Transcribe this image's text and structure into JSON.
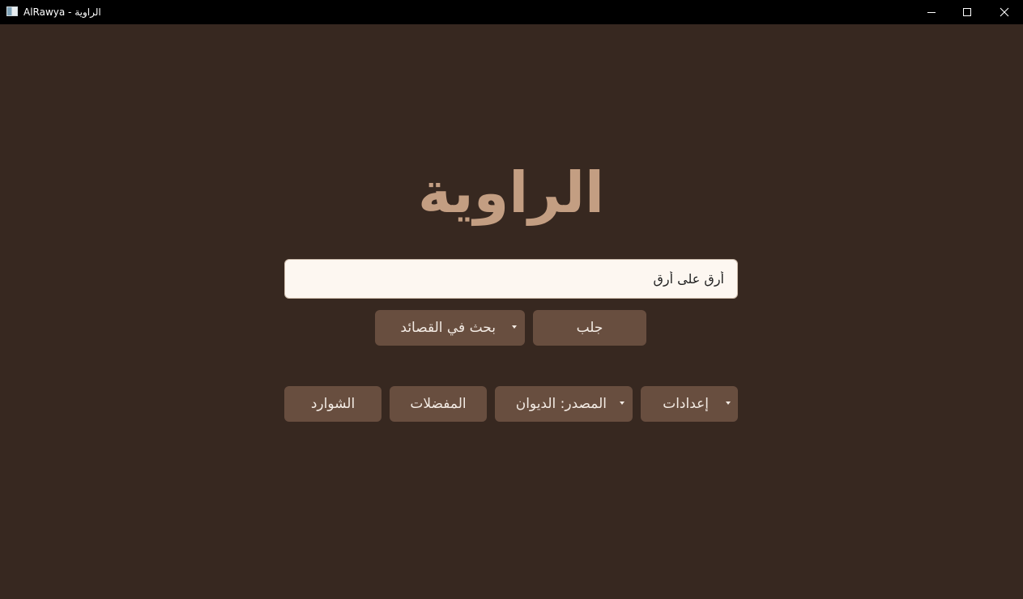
{
  "window": {
    "title": "AlRawya - الراوية",
    "icon": "app-window-icon"
  },
  "main": {
    "app_title": "الراوية",
    "search": {
      "value": "أرق على أرقٍ"
    },
    "fetch_label": "جلب",
    "search_mode_label": "بحث في القصائد",
    "settings_label": "إعدادات",
    "source_label": "المصدر: الديوان",
    "favorites_label": "المفضلات",
    "shawarid_label": "الشوارد"
  },
  "colors": {
    "background": "#372820",
    "button": "#684e3f",
    "title": "#c39e82",
    "input": "#fdf7f1"
  }
}
